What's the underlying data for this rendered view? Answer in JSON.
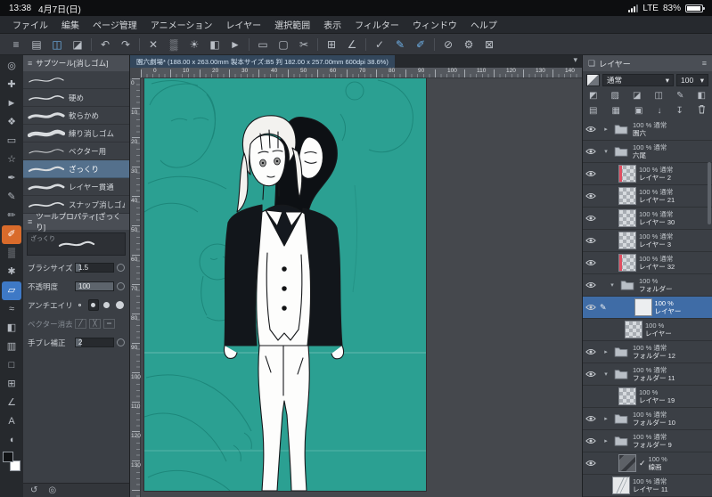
{
  "status_bar": {
    "time": "13:38",
    "date": "4月7日(日)",
    "network": "LTE",
    "battery_percent": "83%"
  },
  "menu_bar": {
    "items": [
      "ファイル",
      "編集",
      "ページ管理",
      "アニメーション",
      "レイヤー",
      "選択範囲",
      "表示",
      "フィルター",
      "ウィンドウ",
      "ヘルプ"
    ]
  },
  "toolbar": {
    "items": [
      {
        "name": "main-menu-icon",
        "glyph": "≡"
      },
      {
        "name": "page-manager-icon",
        "glyph": "▤"
      },
      {
        "name": "spread-view-icon",
        "glyph": "◫",
        "accent": true
      },
      {
        "name": "story-editor-icon",
        "glyph": "◪"
      },
      {
        "type": "sep"
      },
      {
        "name": "undo-icon",
        "glyph": "↶"
      },
      {
        "name": "redo-icon",
        "glyph": "↷"
      },
      {
        "type": "sep"
      },
      {
        "name": "clear-icon",
        "glyph": "✕"
      },
      {
        "name": "clear-outside-selection-icon",
        "glyph": "▒"
      },
      {
        "name": "brightness-icon",
        "glyph": "☀"
      },
      {
        "name": "fill-icon",
        "glyph": "◧"
      },
      {
        "name": "publish-icon",
        "glyph": "►"
      },
      {
        "type": "sep"
      },
      {
        "name": "select-rect-icon",
        "glyph": "▭"
      },
      {
        "name": "deselect-icon",
        "glyph": "▢"
      },
      {
        "name": "crop-icon",
        "glyph": "✂"
      },
      {
        "type": "sep"
      },
      {
        "name": "snap-ruler-icon",
        "glyph": "⊞"
      },
      {
        "name": "snap-angle-icon",
        "glyph": "∠"
      },
      {
        "type": "sep"
      },
      {
        "name": "vector-check-icon",
        "glyph": "✓"
      },
      {
        "name": "pen-correct-icon",
        "glyph": "✎",
        "accent": true
      },
      {
        "name": "brush-correct-icon",
        "glyph": "✐",
        "accent": true
      },
      {
        "type": "sep"
      },
      {
        "name": "no-edit-icon",
        "glyph": "⊘"
      },
      {
        "name": "settings-gear-icon",
        "glyph": "⚙"
      },
      {
        "name": "account-close-icon",
        "glyph": "⊠"
      }
    ]
  },
  "tool_strip": {
    "tools": [
      {
        "name": "zoom-tool",
        "glyph": "◎"
      },
      {
        "name": "move-view-tool",
        "glyph": "✚"
      },
      {
        "name": "operation-tool",
        "glyph": "►"
      },
      {
        "name": "layer-move-tool",
        "glyph": "❖"
      },
      {
        "name": "selection-tool",
        "glyph": "▭"
      },
      {
        "name": "auto-select-tool",
        "glyph": "☆"
      },
      {
        "name": "eyedropper-tool",
        "glyph": "✒"
      },
      {
        "name": "pen-tool",
        "glyph": "✎"
      },
      {
        "name": "pencil-tool",
        "glyph": "✏"
      },
      {
        "name": "brush-tool",
        "glyph": "✐",
        "bg": "orange"
      },
      {
        "name": "airbrush-tool",
        "glyph": "▒"
      },
      {
        "name": "decoration-tool",
        "glyph": "✱"
      },
      {
        "name": "eraser-tool",
        "glyph": "▱",
        "bg": "blue"
      },
      {
        "name": "blend-tool",
        "glyph": "≈"
      },
      {
        "name": "fill-tool",
        "glyph": "◧"
      },
      {
        "name": "gradient-tool",
        "glyph": "▥"
      },
      {
        "name": "figure-tool",
        "glyph": "□"
      },
      {
        "name": "frame-border-tool",
        "glyph": "⊞"
      },
      {
        "name": "ruler-tool",
        "glyph": "∠"
      },
      {
        "name": "text-tool",
        "glyph": "A"
      },
      {
        "name": "balloon-tool",
        "glyph": "◖"
      },
      {
        "type": "swatches"
      }
    ]
  },
  "subtool_panel": {
    "title": "サブツール[消しゴム]",
    "items": [
      {
        "label": "",
        "sw": 1.2
      },
      {
        "label": "硬め",
        "sw": 1.6
      },
      {
        "label": "軟らかめ",
        "sw": 3.2
      },
      {
        "label": "練り消しゴム",
        "sw": 4.5
      },
      {
        "label": "ベクター用",
        "sw": 1.0
      },
      {
        "label": "ざっくり",
        "sw": 2.2,
        "selected": true
      },
      {
        "label": "レイヤー貫通",
        "sw": 2.8
      },
      {
        "label": "スナップ消しゴム",
        "sw": 1.8
      }
    ]
  },
  "tool_property": {
    "title": "ツールプロパティ[ざっくり]",
    "preview_label": "ざっくり",
    "rows": [
      {
        "name": "brush-size-row",
        "label": "ブラシサイズ",
        "value": "1.5",
        "type": "slider",
        "fill": 12
      },
      {
        "name": "opacity-row",
        "label": "不透明度",
        "value": "100",
        "type": "slider",
        "fill": 100
      },
      {
        "name": "anti-aliasing-row",
        "label": "アンチエイリアス",
        "type": "dots",
        "selected": 1
      },
      {
        "name": "vector-erase-row",
        "label": "ベクター消去",
        "type": "icons",
        "muted": true,
        "icons": [
          "╱",
          "╳",
          "═"
        ]
      },
      {
        "name": "stabilization-row",
        "label": "手ブレ補正",
        "value": "2",
        "type": "slider",
        "fill": 15
      }
    ]
  },
  "left_bottom": {
    "icons": [
      {
        "name": "reset-view-icon",
        "glyph": "↺"
      },
      {
        "name": "zoom-nav-icon",
        "glyph": "◎"
      }
    ]
  },
  "canvas": {
    "title": "園六劇場* (188.00 x 263.00mm 製本サイズ:B5 判 182.00 x 257.00mm 600dpi 38.6%)",
    "bg_color": "#2ba092",
    "ruler_h": [
      "0",
      "10",
      "20",
      "30",
      "40",
      "50",
      "60",
      "70",
      "80",
      "90",
      "100",
      "110",
      "120",
      "130",
      "140"
    ],
    "ruler_v": [
      "0",
      "10",
      "20",
      "30",
      "40",
      "50",
      "60",
      "70",
      "80",
      "90",
      "100",
      "110",
      "120",
      "130"
    ]
  },
  "layer_panel": {
    "title": "レイヤー",
    "blend_mode": "通常",
    "opacity": "100",
    "icon_row_a": [
      {
        "name": "clip-to-below-icon",
        "glyph": "◩"
      },
      {
        "name": "lock-transparent-pixels-icon",
        "glyph": "▨"
      },
      {
        "name": "lock-layer-icon",
        "glyph": "◪"
      },
      {
        "name": "mask-enable-icon",
        "glyph": "◫"
      },
      {
        "name": "draft-layer-icon",
        "glyph": "✎"
      },
      {
        "name": "layer-color-icon",
        "glyph": "◧"
      }
    ],
    "icon_row_b": [
      {
        "name": "new-raster-layer-icon",
        "glyph": "▤"
      },
      {
        "name": "new-vector-layer-icon",
        "glyph": "▦"
      },
      {
        "name": "new-folder-icon",
        "glyph": "▣"
      },
      {
        "name": "transfer-down-icon",
        "glyph": "↓"
      },
      {
        "name": "merge-down-icon",
        "glyph": "↧"
      },
      {
        "name": "delete-layer-icon",
        "glyph": "trash"
      }
    ],
    "layers": [
      {
        "eye": true,
        "arrow": "right",
        "kind": "folder",
        "thumb": "folder",
        "info": "100 % 通常",
        "name": "園六",
        "indent": 0
      },
      {
        "eye": true,
        "arrow": "down",
        "kind": "folder",
        "thumb": "folder",
        "info": "100 % 通常",
        "name": "六尾",
        "indent": 0
      },
      {
        "eye": true,
        "arrow": "none",
        "kind": "layer",
        "thumb": "checker-red",
        "info": "100 % 通常",
        "name": "レイヤー 2",
        "indent": 1
      },
      {
        "eye": true,
        "arrow": "none",
        "kind": "layer",
        "thumb": "checker",
        "info": "100 % 通常",
        "name": "レイヤー 21",
        "indent": 1
      },
      {
        "eye": true,
        "arrow": "none",
        "kind": "layer",
        "thumb": "checker",
        "info": "100 % 通常",
        "name": "レイヤー 30",
        "indent": 1
      },
      {
        "eye": true,
        "arrow": "none",
        "kind": "layer",
        "thumb": "checker",
        "info": "100 % 通常",
        "name": "レイヤー 3",
        "indent": 1
      },
      {
        "eye": true,
        "arrow": "none",
        "kind": "layer",
        "thumb": "checker-red",
        "info": "100 % 通常",
        "name": "レイヤー 32",
        "indent": 1
      },
      {
        "eye": true,
        "arrow": "down",
        "kind": "folder",
        "thumb": "folder",
        "info": "100 %",
        "name": "フォルダー",
        "indent": 1
      },
      {
        "eye": true,
        "arrow": "none",
        "kind": "layer",
        "thumb": "white",
        "info": "100 %",
        "name": "レイヤー",
        "indent": 2,
        "selected": true,
        "pencil": true
      },
      {
        "eye": false,
        "arrow": "none",
        "kind": "layer",
        "thumb": "checker",
        "info": "100 %",
        "name": "レイヤー",
        "indent": 2
      },
      {
        "eye": true,
        "arrow": "right",
        "kind": "folder",
        "thumb": "folder",
        "info": "100 % 通常",
        "name": "フォルダー 12",
        "indent": 0
      },
      {
        "eye": true,
        "arrow": "down",
        "kind": "folder",
        "thumb": "folder",
        "info": "100 % 通常",
        "name": "フォルダー 11",
        "indent": 0
      },
      {
        "eye": false,
        "arrow": "none",
        "kind": "layer",
        "thumb": "checker",
        "info": "100 %",
        "name": "レイヤー 19",
        "indent": 1
      },
      {
        "eye": true,
        "arrow": "right",
        "kind": "folder",
        "thumb": "folder",
        "info": "100 % 通常",
        "name": "フォルダー 10",
        "indent": 0
      },
      {
        "eye": true,
        "arrow": "right",
        "kind": "folder",
        "thumb": "folder",
        "info": "100 % 通常",
        "name": "フォルダー 9",
        "indent": 0
      },
      {
        "eye": true,
        "arrow": "none",
        "kind": "layer",
        "thumb": "dark",
        "info": "100 %",
        "name": "線画",
        "indent": 1,
        "check": true
      },
      {
        "eye": false,
        "arrow": "none",
        "kind": "layer",
        "thumb": "sketch",
        "info": "100 % 通常",
        "name": "レイヤー 11",
        "indent": 0
      }
    ]
  }
}
